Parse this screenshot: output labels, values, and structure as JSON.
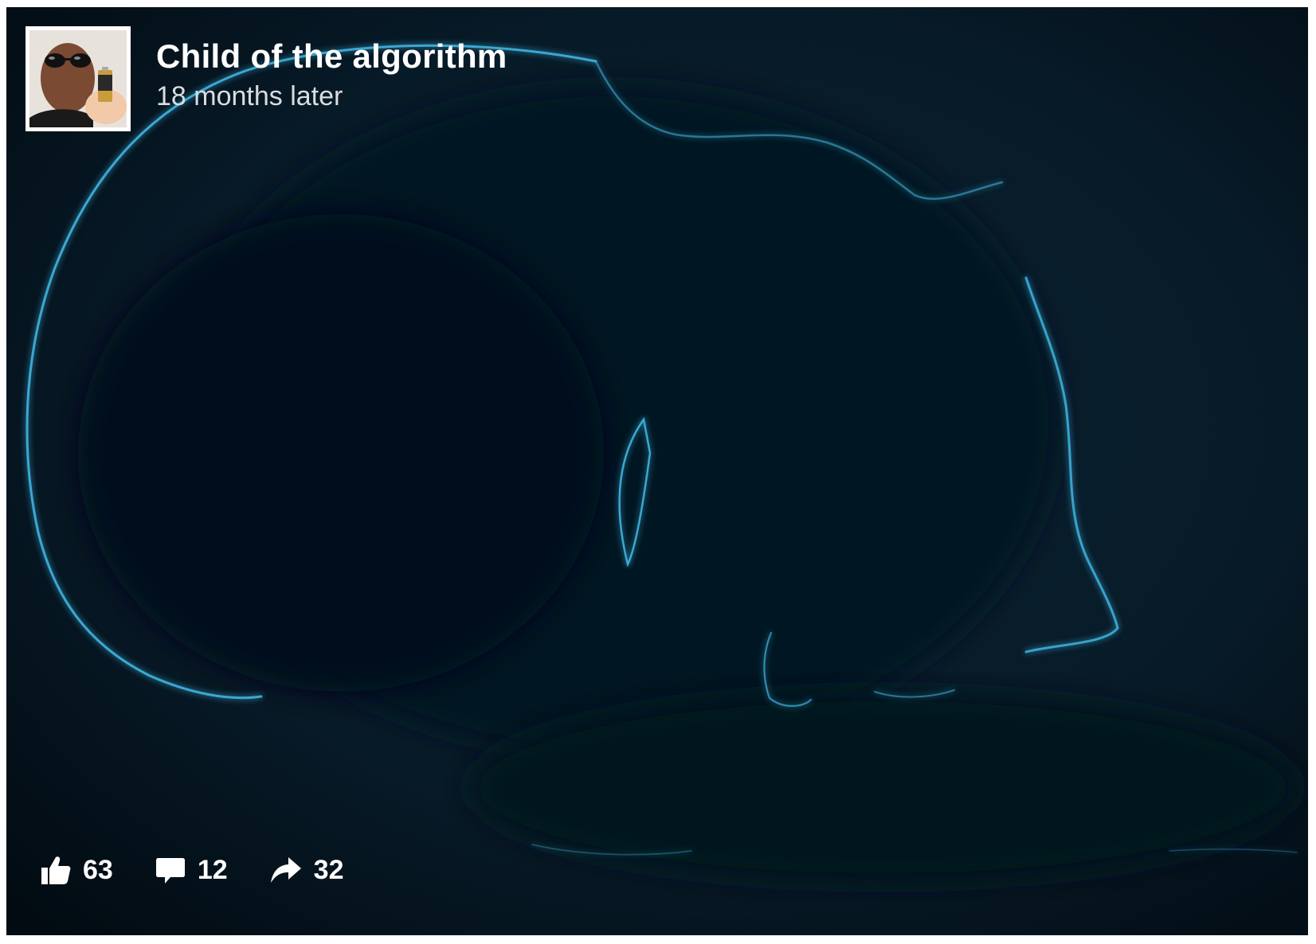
{
  "post": {
    "title": "Child of the algorithm",
    "subtitle": "18 months later",
    "avatar_icon": "profile-photo",
    "background_icon": "glowing-sleeping-baby-outline"
  },
  "actions": {
    "like": {
      "icon": "thumbs-up-icon",
      "count": "63"
    },
    "comment": {
      "icon": "speech-bubble-icon",
      "count": "12"
    },
    "share": {
      "icon": "share-arrow-icon",
      "count": "32"
    }
  },
  "colors": {
    "background": "#04121d",
    "glow": "#3fb4e0",
    "text": "#ffffff"
  }
}
